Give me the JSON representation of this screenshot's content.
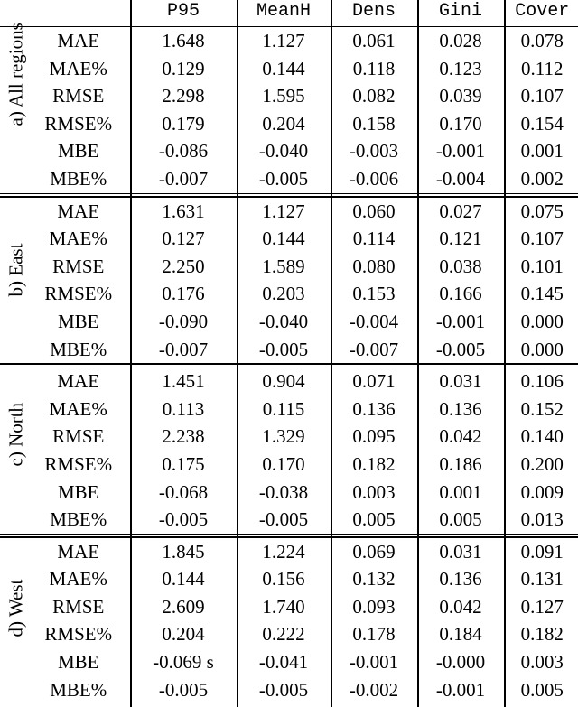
{
  "table": {
    "columns": [
      "P95",
      "MeanH",
      "Dens",
      "Gini",
      "Cover"
    ],
    "metric_header": "",
    "group_header": "",
    "blocks": [
      {
        "label": "a) All regions",
        "rows": [
          {
            "metric": "MAE",
            "values": [
              "1.648",
              "1.127",
              "0.061",
              "0.028",
              "0.078"
            ]
          },
          {
            "metric": "MAE%",
            "values": [
              "0.129",
              "0.144",
              "0.118",
              "0.123",
              "0.112"
            ]
          },
          {
            "metric": "RMSE",
            "values": [
              "2.298",
              "1.595",
              "0.082",
              "0.039",
              "0.107"
            ]
          },
          {
            "metric": "RMSE%",
            "values": [
              "0.179",
              "0.204",
              "0.158",
              "0.170",
              "0.154"
            ]
          },
          {
            "metric": "MBE",
            "values": [
              "-0.086",
              "-0.040",
              "-0.003",
              "-0.001",
              "0.001"
            ]
          },
          {
            "metric": "MBE%",
            "values": [
              "-0.007",
              "-0.005",
              "-0.006",
              "-0.004",
              "0.002"
            ]
          }
        ]
      },
      {
        "label": "b) East",
        "rows": [
          {
            "metric": "MAE",
            "values": [
              "1.631",
              "1.127",
              "0.060",
              "0.027",
              "0.075"
            ]
          },
          {
            "metric": "MAE%",
            "values": [
              "0.127",
              "0.144",
              "0.114",
              "0.121",
              "0.107"
            ]
          },
          {
            "metric": "RMSE",
            "values": [
              "2.250",
              "1.589",
              "0.080",
              "0.038",
              "0.101"
            ]
          },
          {
            "metric": "RMSE%",
            "values": [
              "0.176",
              "0.203",
              "0.153",
              "0.166",
              "0.145"
            ]
          },
          {
            "metric": "MBE",
            "values": [
              "-0.090",
              "-0.040",
              "-0.004",
              "-0.001",
              "0.000"
            ]
          },
          {
            "metric": "MBE%",
            "values": [
              "-0.007",
              "-0.005",
              "-0.007",
              "-0.005",
              "0.000"
            ]
          }
        ]
      },
      {
        "label": "c) North",
        "rows": [
          {
            "metric": "MAE",
            "values": [
              "1.451",
              "0.904",
              "0.071",
              "0.031",
              "0.106"
            ]
          },
          {
            "metric": "MAE%",
            "values": [
              "0.113",
              "0.115",
              "0.136",
              "0.136",
              "0.152"
            ]
          },
          {
            "metric": "RMSE",
            "values": [
              "2.238",
              "1.329",
              "0.095",
              "0.042",
              "0.140"
            ]
          },
          {
            "metric": "RMSE%",
            "values": [
              "0.175",
              "0.170",
              "0.182",
              "0.186",
              "0.200"
            ]
          },
          {
            "metric": "MBE",
            "values": [
              "-0.068",
              "-0.038",
              "0.003",
              "0.001",
              "0.009"
            ]
          },
          {
            "metric": "MBE%",
            "values": [
              "-0.005",
              "-0.005",
              "0.005",
              "0.005",
              "0.013"
            ]
          }
        ]
      },
      {
        "label": "d) West",
        "rows": [
          {
            "metric": "MAE",
            "values": [
              "1.845",
              "1.224",
              "0.069",
              "0.031",
              "0.091"
            ]
          },
          {
            "metric": "MAE%",
            "values": [
              "0.144",
              "0.156",
              "0.132",
              "0.136",
              "0.131"
            ]
          },
          {
            "metric": "RMSE",
            "values": [
              "2.609",
              "1.740",
              "0.093",
              "0.042",
              "0.127"
            ]
          },
          {
            "metric": "RMSE%",
            "values": [
              "0.204",
              "0.222",
              "0.178",
              "0.184",
              "0.182"
            ]
          },
          {
            "metric": "MBE",
            "values": [
              "-0.069 s",
              "-0.041",
              "-0.001",
              "-0.000",
              "0.003"
            ]
          },
          {
            "metric": "MBE%",
            "values": [
              "-0.005",
              "-0.005",
              "-0.002",
              "-0.001",
              "0.005"
            ]
          }
        ]
      }
    ]
  }
}
